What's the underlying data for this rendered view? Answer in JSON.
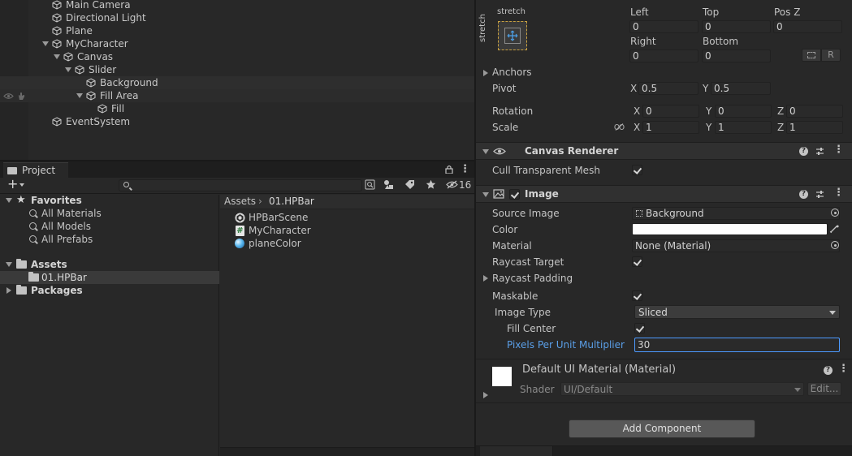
{
  "hierarchy": {
    "items": [
      {
        "label": "Main Camera"
      },
      {
        "label": "Directional Light"
      },
      {
        "label": "Plane"
      },
      {
        "label": "MyCharacter"
      },
      {
        "label": "Canvas"
      },
      {
        "label": "Slider"
      },
      {
        "label": "Background"
      },
      {
        "label": "Fill Area"
      },
      {
        "label": "Fill"
      },
      {
        "label": "EventSystem"
      }
    ]
  },
  "project": {
    "tab_label": "Project",
    "hidden_count": "16",
    "favorites": {
      "label": "Favorites",
      "items": [
        "All Materials",
        "All Models",
        "All Prefabs"
      ]
    },
    "assets_label": "Assets",
    "assets_child": "01.HPBar",
    "packages_label": "Packages",
    "breadcrumb": {
      "root": "Assets",
      "separator": "›",
      "current": "01.HPBar"
    },
    "files": [
      {
        "label": "HPBarScene",
        "icon": "unity-scene-icon"
      },
      {
        "label": "MyCharacter",
        "icon": "csharp-script-icon"
      },
      {
        "label": "planeColor",
        "icon": "material-sphere-icon"
      }
    ]
  },
  "inspector": {
    "rect": {
      "anchor_preset_top": "stretch",
      "anchor_preset_side": "stretch",
      "left_label": "Left",
      "left_value": "0",
      "top_label": "Top",
      "top_value": "0",
      "posz_label": "Pos Z",
      "posz_value": "0",
      "right_label": "Right",
      "right_value": "0",
      "bottom_label": "Bottom",
      "bottom_value": "0",
      "r_button": "R",
      "anchors_label": "Anchors",
      "pivot_label": "Pivot",
      "pivot_x_label": "X",
      "pivot_x": "0.5",
      "pivot_y_label": "Y",
      "pivot_y": "0.5",
      "rotation_label": "Rotation",
      "rot_x_label": "X",
      "rot_x": "0",
      "rot_y_label": "Y",
      "rot_y": "0",
      "rot_z_label": "Z",
      "rot_z": "0",
      "scale_label": "Scale",
      "scale_x_label": "X",
      "scale_x": "1",
      "scale_y_label": "Y",
      "scale_y": "1",
      "scale_z_label": "Z",
      "scale_z": "1"
    },
    "canvas_renderer": {
      "title": "Canvas Renderer",
      "cull_label": "Cull Transparent Mesh",
      "cull_checked": true
    },
    "image": {
      "title": "Image",
      "enabled": true,
      "source_image_label": "Source Image",
      "source_image_value": "Background",
      "color_label": "Color",
      "color_value": "#ffffff",
      "material_label": "Material",
      "material_value": "None (Material)",
      "raycast_target_label": "Raycast Target",
      "raycast_target": true,
      "raycast_padding_label": "Raycast Padding",
      "maskable_label": "Maskable",
      "maskable": true,
      "image_type_label": "Image Type",
      "image_type_value": "Sliced",
      "fill_center_label": "Fill Center",
      "fill_center": true,
      "ppu_label": "Pixels Per Unit Multiplier",
      "ppu_value": "30"
    },
    "material_preview": {
      "title": "Default UI Material (Material)",
      "shader_label": "Shader",
      "shader_value": "UI/Default",
      "edit_button": "Edit..."
    },
    "add_component_label": "Add Component"
  },
  "colors": {
    "panel": "#282828",
    "accent_blue": "#4c9aff",
    "selected_row": "#2e2e2e"
  }
}
